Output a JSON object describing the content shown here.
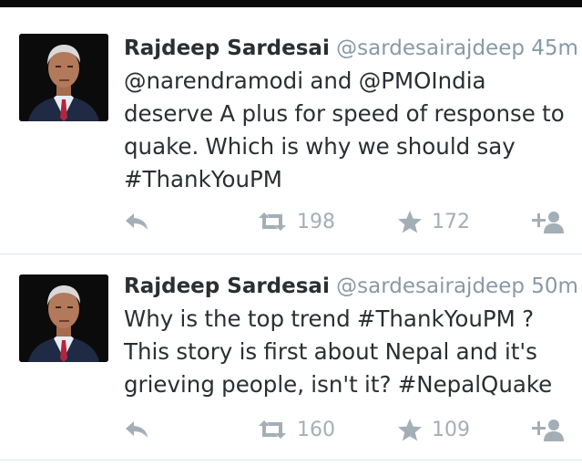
{
  "tweets": [
    {
      "name": "Rajdeep Sardesai",
      "handle": "@sardesairajdeep",
      "time": "45m",
      "text": "@narendramodi and @PMOIndia deserve A plus for speed of response to quake. Which is why we should say #ThankYouPM",
      "retweets": "198",
      "favorites": "172"
    },
    {
      "name": "Rajdeep Sardesai",
      "handle": "@sardesairajdeep",
      "time": "50m",
      "text": "Why is the top trend #ThankYouPM ? This story is first about Nepal and it's grieving people, isn't it? #NepalQuake",
      "retweets": "160",
      "favorites": "109"
    }
  ],
  "icons": {
    "reply": "reply-icon",
    "retweet": "retweet-icon",
    "favorite": "star-icon",
    "follow": "follow-icon"
  },
  "colors": {
    "text": "#292f33",
    "meta": "#8899a6",
    "action": "#a4aeb7",
    "divider": "#e1e8ed"
  }
}
